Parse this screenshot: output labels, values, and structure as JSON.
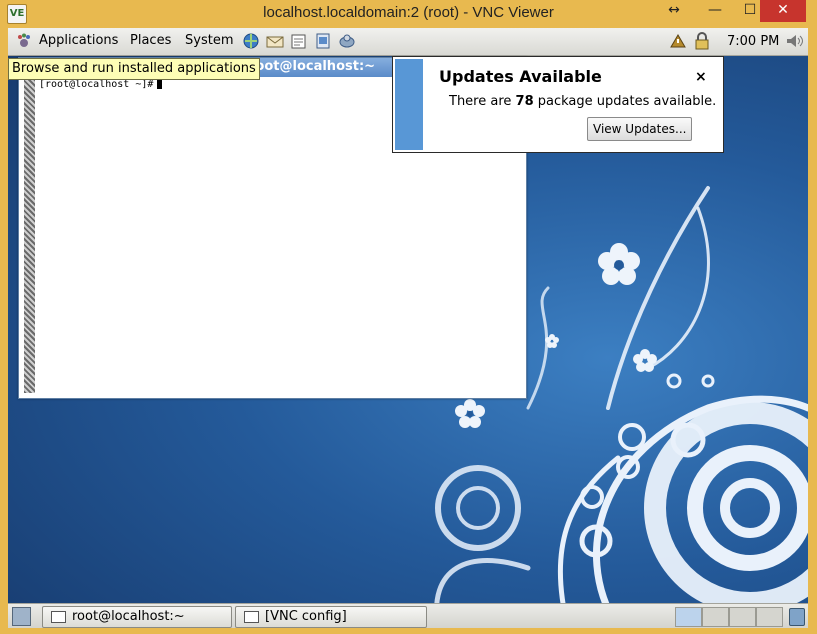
{
  "vnc_window": {
    "app_icon_label": "VE",
    "title": "localhost.localdomain:2 (root) - VNC Viewer",
    "resize_glyph": "↔",
    "minimize_glyph": "—",
    "maximize_glyph": "☐",
    "close_glyph": "✕"
  },
  "top_panel": {
    "menus": {
      "applications": "Applications",
      "places": "Places",
      "system": "System"
    },
    "launchers": [
      "web-browser-icon",
      "mail-icon",
      "text-editor-icon",
      "notes-icon",
      "network-icon"
    ],
    "tray_icons": [
      "update-notifier-icon",
      "lock-icon",
      "volume-icon"
    ],
    "clock": "7:00 PM"
  },
  "tooltip": {
    "text": "Browse and run installed applications"
  },
  "terminal": {
    "title": "root@localhost:~",
    "prompt": "[root@localhost ~]#"
  },
  "notification": {
    "title": "Updates Available",
    "close": "×",
    "body_prefix": "There are ",
    "count": "78",
    "body_suffix": " package updates available.",
    "button": "View Updates..."
  },
  "bottom_panel": {
    "tasks": [
      {
        "label": "root@localhost:~"
      },
      {
        "label": "[VNC config]"
      }
    ],
    "workspaces": 4
  },
  "colors": {
    "vnc_frame": "#e8b94f",
    "close_button": "#c7342d",
    "notification_stripe": "#5897d6",
    "desktop_blue": "#245a9a"
  }
}
